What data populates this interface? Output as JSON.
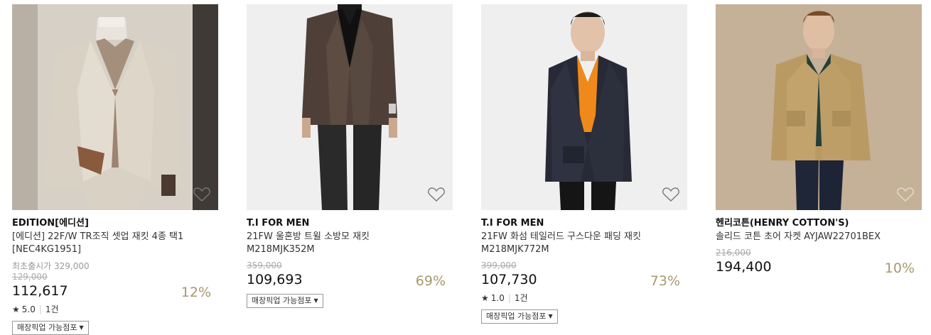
{
  "products": [
    {
      "brand": "EDITION[에디션]",
      "name": "[에디션] 22F/W TR조직 셋업 재킷 4종 택1",
      "code": "[NEC4KG1951]",
      "first_release": "최초출시가 329,000",
      "original_price": "129,000",
      "price": "112,617",
      "discount": "12%",
      "rating": "5.0",
      "review_count": "1건",
      "pickup_label": "매장픽업 가능점포",
      "heart_icon": "heart-outline-icon"
    },
    {
      "brand": "T.I FOR MEN",
      "name": "21FW 울혼방 트윌 소방모 재킷",
      "code": "M218MJK352M",
      "original_price": "359,000",
      "price": "109,693",
      "discount": "69%",
      "pickup_label": "매장픽업 가능점포",
      "heart_icon": "heart-outline-icon"
    },
    {
      "brand": "T.I FOR MEN",
      "name": "21FW 화섬 테일러드 구스다운 패딩 재킷",
      "code": "M218MJK772M",
      "original_price": "399,000",
      "price": "107,730",
      "discount": "73%",
      "rating": "1.0",
      "review_count": "1건",
      "pickup_label": "매장픽업 가능점포",
      "heart_icon": "heart-outline-icon"
    },
    {
      "brand": "헨리코튼(HENRY COTTON'S)",
      "name": "솔리드 코튼 초어 자켓 AYJAW22701BEX",
      "original_price": "216,000",
      "price": "194,400",
      "discount": "10%",
      "heart_icon": "heart-outline-icon"
    }
  ],
  "colors": {
    "discount": "#a8986c",
    "image_bg": "#eeeeee"
  }
}
